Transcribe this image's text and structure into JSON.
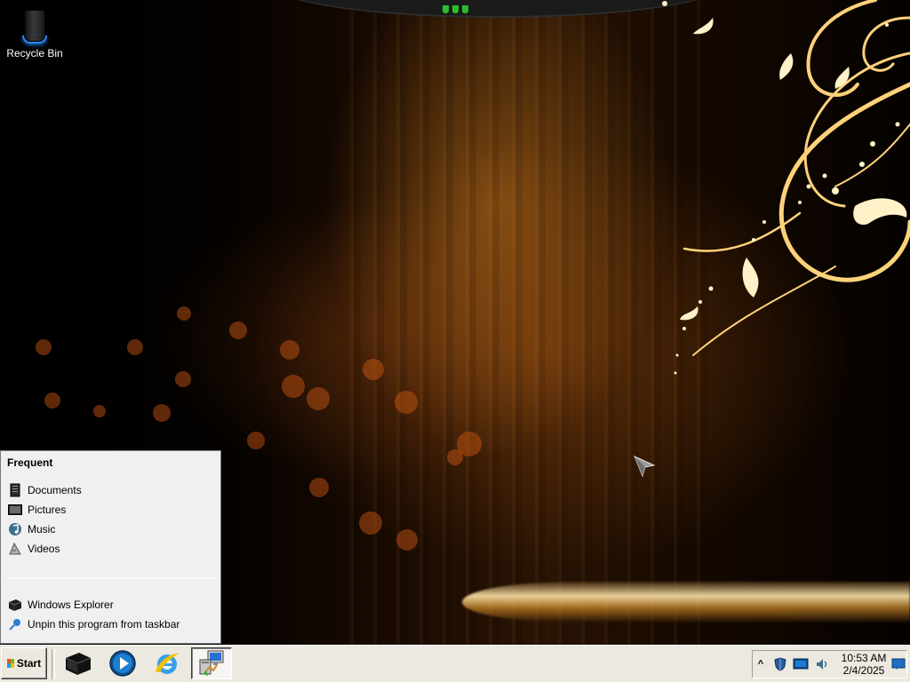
{
  "desktop": {
    "icons": [
      {
        "label": "Recycle Bin",
        "icon": "recycle-bin-icon"
      }
    ]
  },
  "jumplist": {
    "heading": "Frequent",
    "frequent": [
      {
        "label": "Documents",
        "icon": "documents-icon"
      },
      {
        "label": "Pictures",
        "icon": "pictures-icon"
      },
      {
        "label": "Music",
        "icon": "music-icon"
      },
      {
        "label": "Videos",
        "icon": "videos-icon"
      }
    ],
    "tasks": [
      {
        "label": "Windows Explorer",
        "icon": "windows-explorer-icon"
      },
      {
        "label": "Unpin this program from taskbar",
        "icon": "unpin-icon"
      }
    ]
  },
  "taskbar": {
    "start_label": "Start",
    "pinned": [
      {
        "icon": "windows-explorer-icon"
      },
      {
        "icon": "media-player-icon"
      },
      {
        "icon": "internet-explorer-icon"
      },
      {
        "icon": "network-computer-icon",
        "active": true
      }
    ],
    "tray": {
      "expand_glyph": "^",
      "icons": [
        "security-shield-icon",
        "display-icon",
        "volume-icon",
        "action-center-icon"
      ],
      "time": "10:53 AM",
      "date": "2/4/2025"
    }
  }
}
